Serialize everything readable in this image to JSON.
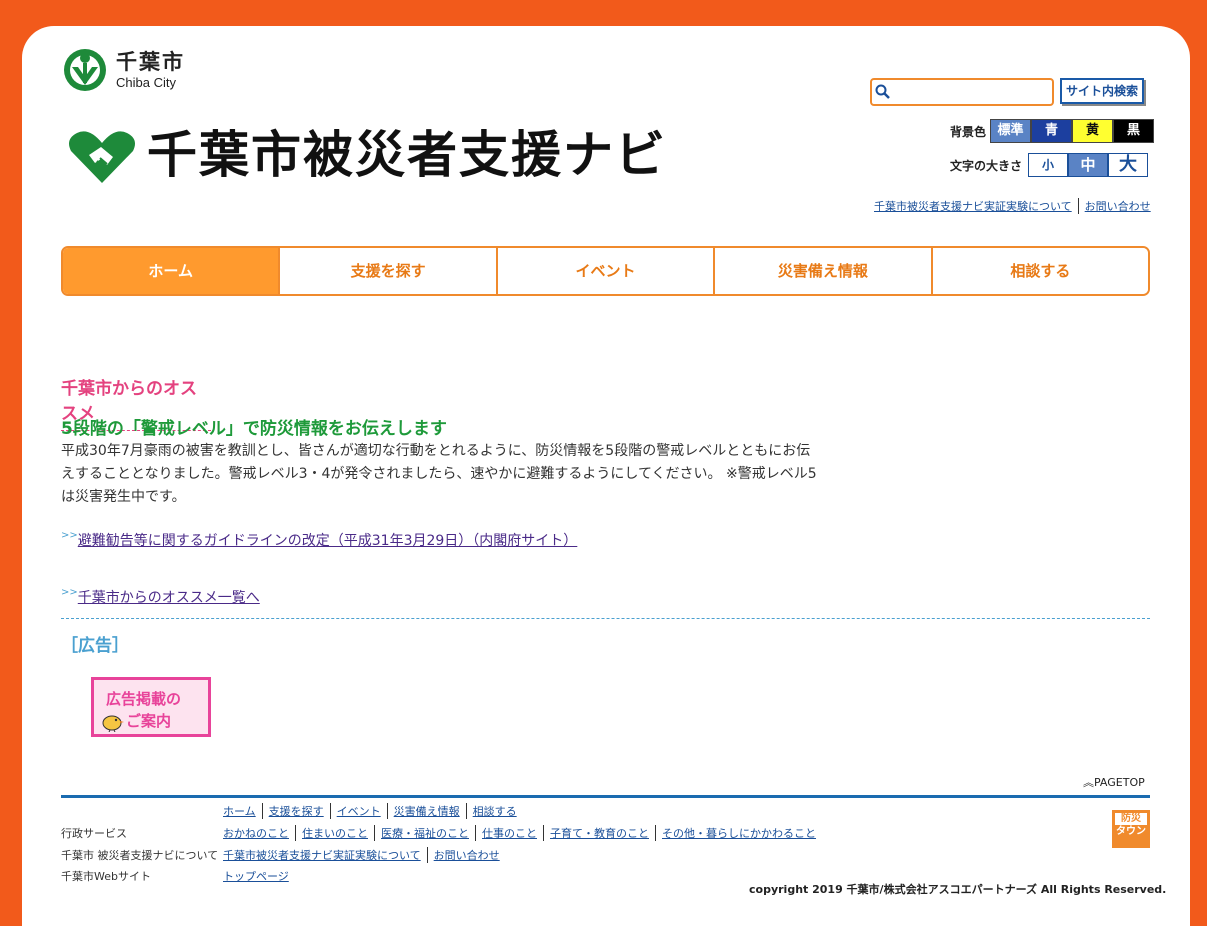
{
  "header": {
    "city_ja": "千葉市",
    "city_en": "Chiba City",
    "site_title": "千葉市被災者支援ナビ",
    "search_button": "サイト内検索",
    "bg_label": "背景色",
    "bg_options": [
      "標準",
      "青",
      "黄",
      "黒"
    ],
    "font_label": "文字の大きさ",
    "font_options": [
      "小",
      "中",
      "大"
    ],
    "links": [
      "千葉市被災者支援ナビ実証実験について",
      "お問い合わせ"
    ]
  },
  "nav": [
    "ホーム",
    "支援を探す",
    "イベント",
    "災害備え情報",
    "相談する"
  ],
  "main": {
    "section_title": "千葉市からのオススメ",
    "article_title": "5段階の「警戒レベル」で防災情報をお伝えします",
    "article_body": "平成30年7月豪雨の被害を教訓とし、皆さんが適切な行動をとれるように、防災情報を5段階の警戒レベルとともにお伝えすることとなりました。警戒レベル3・4が発令されましたら、速やかに避難するようにしてください。 ※警戒レベル5は災害発生中です。",
    "link1": "避難勧告等に関するガイドラインの改定（平成31年3月29日）（内閣府サイト）",
    "link2": "千葉市からのオススメ一覧へ",
    "link_arrow": ">>",
    "ad_label": "［広告］",
    "ad_line1": "広告掲載の",
    "ad_line2": "ご案内"
  },
  "footer": {
    "pagetop": "PAGETOP",
    "nav_links": [
      "ホーム",
      "支援を探す",
      "イベント",
      "災害備え情報",
      "相談する"
    ],
    "gyosei_label": "行政サービス",
    "gyosei_links": [
      "おかねのこと",
      "住まいのこと",
      "医療・福祉のこと",
      "仕事のこと",
      "子育て・教育のこと",
      "その他・暮らしにかかわること"
    ],
    "about_label": "千葉市 被災者支援ナビについて",
    "about_links": [
      "千葉市被災者支援ナビ実証実験について",
      "お問い合わせ"
    ],
    "web_label": "千葉市Webサイト",
    "web_links": [
      "トップページ"
    ],
    "bousai_top": "防災",
    "bousai_bottom": "タウン",
    "copyright": "copyright 2019 千葉市/株式会社アスコエパートナーズ All Rights Reserved."
  },
  "colors": {
    "brand_orange": "#f25a1b",
    "nav_orange": "#f08a2c",
    "green": "#1e9a3a",
    "pink": "#e4427f"
  }
}
